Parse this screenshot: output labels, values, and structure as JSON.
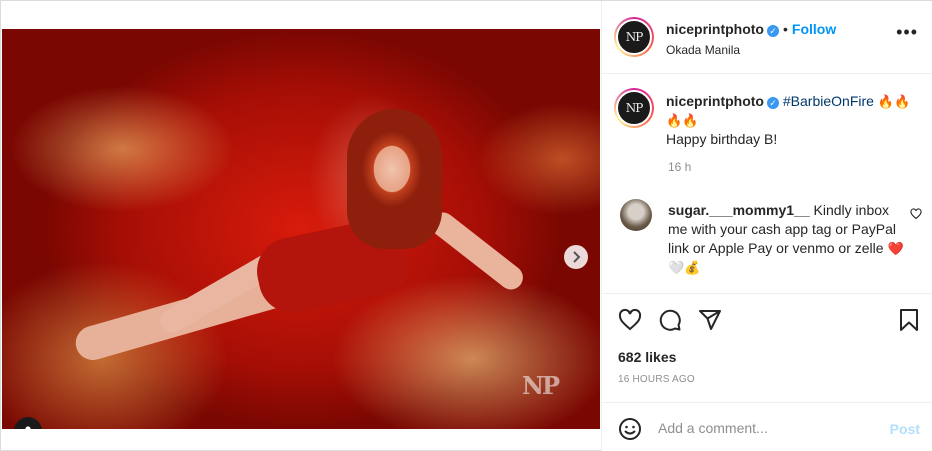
{
  "media": {
    "watermark": "NP",
    "carousel_count": 10,
    "carousel_active": 0
  },
  "header": {
    "avatar_text": "NP",
    "username": "niceprintphoto",
    "bullet": "•",
    "follow_label": "Follow",
    "location": "Okada Manila",
    "more_label": "•••"
  },
  "caption": {
    "username": "niceprintphoto",
    "hashtag": "#BarbieOnFire",
    "emojis": "🔥🔥🔥🔥",
    "text": "Happy birthday B!",
    "time": "16 h"
  },
  "comment": {
    "username": "sugar.___mommy1__",
    "text": "Kindly inbox me with your cash app tag or PayPal link or Apple Pay or venmo or zelle",
    "emojis": "❤️ 🤍💰"
  },
  "likes": "682 likes",
  "post_time": "16 HOURS AGO",
  "add_comment": {
    "placeholder": "Add a comment...",
    "post_label": "Post"
  },
  "colors": {
    "accent": "#0095f6",
    "post_disabled": "#b2dffc",
    "hashtag": "#00376b",
    "muted": "#8e8e8e"
  }
}
